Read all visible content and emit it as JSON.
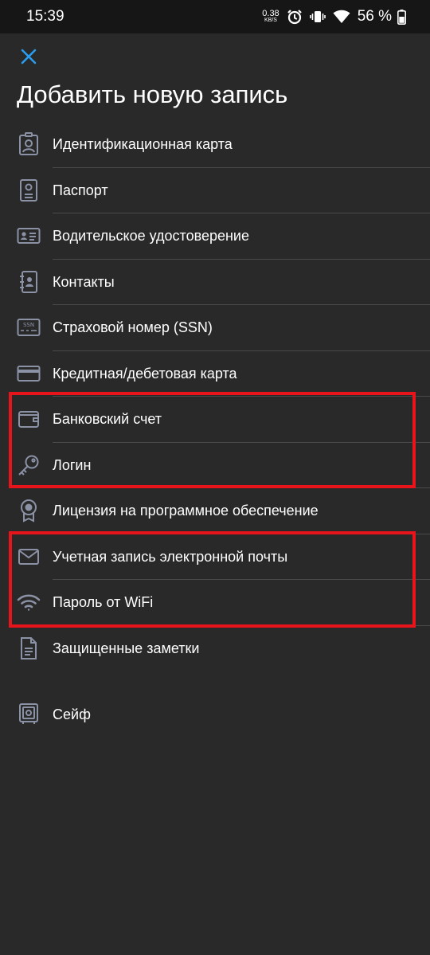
{
  "status_bar": {
    "time": "15:39",
    "net_speed_value": "0.38",
    "net_speed_unit": "KB/S",
    "battery_percent": "56 %"
  },
  "header": {
    "title": "Добавить новую запись"
  },
  "menu": {
    "items": [
      {
        "label": "Идентификационная карта",
        "icon": "id-card-icon"
      },
      {
        "label": "Паспорт",
        "icon": "passport-icon"
      },
      {
        "label": "Водительское удостоверение",
        "icon": "driver-license-icon"
      },
      {
        "label": "Контакты",
        "icon": "contacts-icon"
      },
      {
        "label": "Страховой номер (SSN)",
        "icon": "ssn-card-icon"
      },
      {
        "label": "Кредитная/дебетовая карта",
        "icon": "credit-card-icon"
      },
      {
        "label": "Банковский счет",
        "icon": "wallet-icon"
      },
      {
        "label": "Логин",
        "icon": "key-icon"
      },
      {
        "label": "Лицензия на программное обеспечение",
        "icon": "license-badge-icon"
      },
      {
        "label": "Учетная запись электронной почты",
        "icon": "mail-icon"
      },
      {
        "label": "Пароль от WiFi",
        "icon": "wifi-icon"
      },
      {
        "label": "Защищенные заметки",
        "icon": "note-icon"
      }
    ],
    "safe": {
      "label": "Сейф",
      "icon": "safe-icon"
    }
  },
  "colors": {
    "background": "#292929",
    "status_bar": "#161616",
    "icon": "#8b92a6",
    "accent": "#2a9cf0",
    "highlight": "#e8141c",
    "divider": "#4a4a4a"
  }
}
